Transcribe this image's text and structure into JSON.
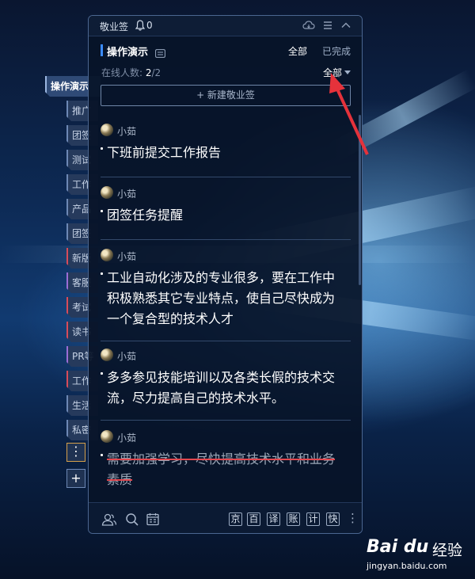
{
  "window": {
    "app_name": "敬业签",
    "notification_count": "0"
  },
  "header": {
    "group_title": "操作演示",
    "filter_all": "全部",
    "filter_done": "已完成"
  },
  "status": {
    "online_label": "在线人数:",
    "online_count": "2",
    "online_total": "/2",
    "scope": "全部"
  },
  "new_note_button": "+ 新建敬业签",
  "notes": [
    {
      "author": "小茹",
      "text": "下班前提交工作报告",
      "done": false
    },
    {
      "author": "小茹",
      "text": "团签任务提醒",
      "done": false
    },
    {
      "author": "小茹",
      "text": "工业自动化涉及的专业很多，要在工作中积极熟悉其它专业特点，使自己尽快成为一个复合型的技术人才",
      "done": false
    },
    {
      "author": "小茹",
      "text": "多多参见技能培训以及各类长假的技术交流，尽力提高自己的技术水平。",
      "done": false
    },
    {
      "author": "小茹",
      "text": "需要加强学习，尽快提高技术水平和业务素质",
      "done": true
    }
  ],
  "side_tabs": [
    "操作演示",
    "推广",
    "团签",
    "测试",
    "工作",
    "产品",
    "团签",
    "新版",
    "客服",
    "考试",
    "读书",
    "PR等",
    "工作",
    "生活",
    "私密"
  ],
  "side_more": "⋮",
  "side_add": "+",
  "toolbar_buttons": [
    "京",
    "百",
    "译",
    "账",
    "计",
    "快"
  ],
  "toolbar_more": "⋮",
  "watermark": {
    "logo": "Bai du",
    "text": "经验",
    "url": "jingyan.baidu.com"
  },
  "colors": {
    "accent": "#3b8cff",
    "arrow": "#e5323b",
    "strike": "#e2484f"
  }
}
